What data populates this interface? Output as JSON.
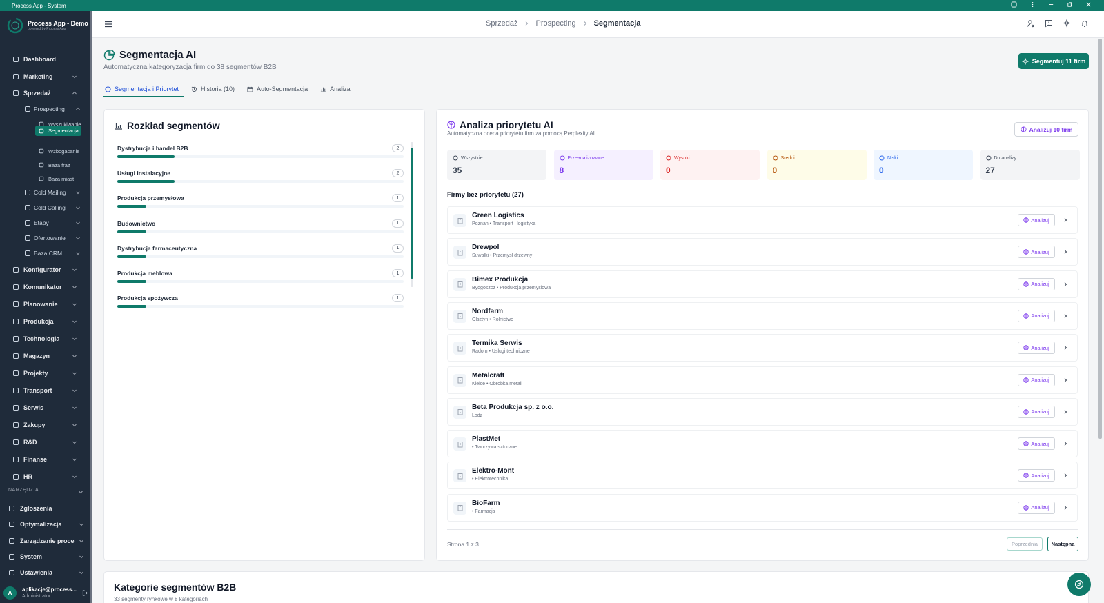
{
  "window": {
    "title": "Process App - System"
  },
  "brand": {
    "name": "Process App - Demo",
    "tagline": "powered by Process App"
  },
  "sidebar": {
    "items": [
      {
        "label": "Dashboard",
        "icon": "grid-icon"
      },
      {
        "label": "Marketing",
        "icon": "megaphone-icon"
      },
      {
        "label": "Sprzedaż",
        "icon": "trending-up-icon"
      },
      {
        "label": "Prospecting",
        "icon": "target-icon"
      },
      {
        "label": "Wyszukiwanie",
        "icon": "search-icon"
      },
      {
        "label": "Segmentacja",
        "icon": "pie-chart-icon"
      },
      {
        "label": "Wzbogacanie",
        "icon": "sparkle-icon"
      },
      {
        "label": "Baza fraz",
        "icon": "tag-icon"
      },
      {
        "label": "Baza miast",
        "icon": "map-pin-icon"
      },
      {
        "label": "Cold Mailing",
        "icon": "send-icon"
      },
      {
        "label": "Cold Calling",
        "icon": "phone-icon"
      },
      {
        "label": "Etapy",
        "icon": "trending-up-icon"
      },
      {
        "label": "Ofertowanie",
        "icon": "file-icon"
      },
      {
        "label": "Baza CRM",
        "icon": "database-icon"
      },
      {
        "label": "Konfigurator",
        "icon": "sliders-icon"
      },
      {
        "label": "Komunikator",
        "icon": "message-icon"
      },
      {
        "label": "Planowanie",
        "icon": "calendar-icon"
      },
      {
        "label": "Produkcja",
        "icon": "factory-icon"
      },
      {
        "label": "Technologia",
        "icon": "cpu-icon"
      },
      {
        "label": "Magazyn",
        "icon": "box-icon"
      },
      {
        "label": "Projekty",
        "icon": "folder-icon"
      },
      {
        "label": "Transport",
        "icon": "truck-icon"
      },
      {
        "label": "Serwis",
        "icon": "wrench-icon"
      },
      {
        "label": "Zakupy",
        "icon": "package-icon"
      },
      {
        "label": "R&D",
        "icon": "lightbulb-icon"
      },
      {
        "label": "Finanse",
        "icon": "wallet-icon"
      },
      {
        "label": "HR",
        "icon": "users-icon"
      }
    ],
    "tools_label": "NARZĘDZIA",
    "tools": [
      {
        "label": "Zgłoszenia",
        "icon": "ticket-icon"
      },
      {
        "label": "Optymalizacja",
        "icon": "bolt-icon"
      },
      {
        "label": "Zarządzanie proce...",
        "icon": "workflow-icon"
      },
      {
        "label": "System",
        "icon": "sparkle-icon"
      },
      {
        "label": "Ustawienia",
        "icon": "gear-icon"
      }
    ],
    "user": {
      "initial": "A",
      "email": "aplikacje@process...",
      "role": "Administrator"
    }
  },
  "breadcrumb": [
    "Sprzedaż",
    "Prospecting",
    "Segmentacja"
  ],
  "page": {
    "title": "Segmentacja AI",
    "subtitle": "Automatyczna kategoryzacja firm do 38 segmentów B2B",
    "primary_button": "Segmentuj 11 firm",
    "tabs": [
      "Segmentacja i Priorytet",
      "Historia (10)",
      "Auto-Segmentacja",
      "Analiza"
    ]
  },
  "segments": {
    "title": "Rozkład segmentów",
    "items": [
      {
        "name": "Dystrybucja i handel B2B",
        "count": "2",
        "share": 0.2
      },
      {
        "name": "Usługi instalacyjne",
        "count": "2",
        "share": 0.2
      },
      {
        "name": "Produkcja przemysłowa",
        "count": "1",
        "share": 0.1
      },
      {
        "name": "Budownictwo",
        "count": "1",
        "share": 0.1
      },
      {
        "name": "Dystrybucja farmaceutyczna",
        "count": "1",
        "share": 0.1
      },
      {
        "name": "Produkcja meblowa",
        "count": "1",
        "share": 0.1
      },
      {
        "name": "Produkcja spożywcza",
        "count": "1",
        "share": 0.1
      }
    ]
  },
  "priority": {
    "title": "Analiza priorytetu AI",
    "subtitle": "Automatyczna ocena priorytetu firm za pomocą Perplexity AI",
    "button": "Analizuj 10 firm",
    "stats": [
      {
        "label": "Wszystkie",
        "value": "35",
        "color": "#374151",
        "bg": "#f3f4f6"
      },
      {
        "label": "Przeanalizowane",
        "value": "8",
        "color": "#7c3aed",
        "bg": "#f5f0ff"
      },
      {
        "label": "Wysoki",
        "value": "0",
        "color": "#dc2626",
        "bg": "#fef2f2"
      },
      {
        "label": "Średni",
        "value": "0",
        "color": "#b45309",
        "bg": "#fefce8"
      },
      {
        "label": "Niski",
        "value": "0",
        "color": "#2563eb",
        "bg": "#eff6ff"
      },
      {
        "label": "Do analizy",
        "value": "27",
        "color": "#374151",
        "bg": "#f3f4f6"
      }
    ],
    "list_title": "Firmy bez priorytetu (27)",
    "analyze_label": "Analizuj",
    "firms": [
      {
        "name": "Green Logistics",
        "meta": "Poznan  • Transport i logistyka"
      },
      {
        "name": "Drewpol",
        "meta": "Suwalki  • Przemysl drzewny"
      },
      {
        "name": "Bimex Produkcja",
        "meta": "Bydgoszcz  • Produkcja przemyslowa"
      },
      {
        "name": "Nordfarm",
        "meta": "Olsztyn  • Rolnictwo"
      },
      {
        "name": "Termika Serwis",
        "meta": "Radom  • Uslugi techniczne"
      },
      {
        "name": "Metalcraft",
        "meta": "Kielce  • Obrobka metali"
      },
      {
        "name": "Beta Produkcja sp. z o.o.",
        "meta": "Lodz"
      },
      {
        "name": "PlastMet",
        "meta": "• Tworzywa sztuczne"
      },
      {
        "name": "Elektro-Mont",
        "meta": "• Elektrotechnika"
      },
      {
        "name": "BioFarm",
        "meta": "• Farmacja"
      }
    ],
    "pager": {
      "text": "Strona 1 z 3",
      "prev": "Poprzednia",
      "next": "Następna"
    }
  },
  "categories": {
    "title": "Kategorie segmentów B2B",
    "subtitle": "33 segmenty rynkowe w 8 kategoriach"
  },
  "colors": {
    "accent": "#0f7a6a",
    "sidebar": "#1f2b3a",
    "purple": "#7c3aed"
  }
}
